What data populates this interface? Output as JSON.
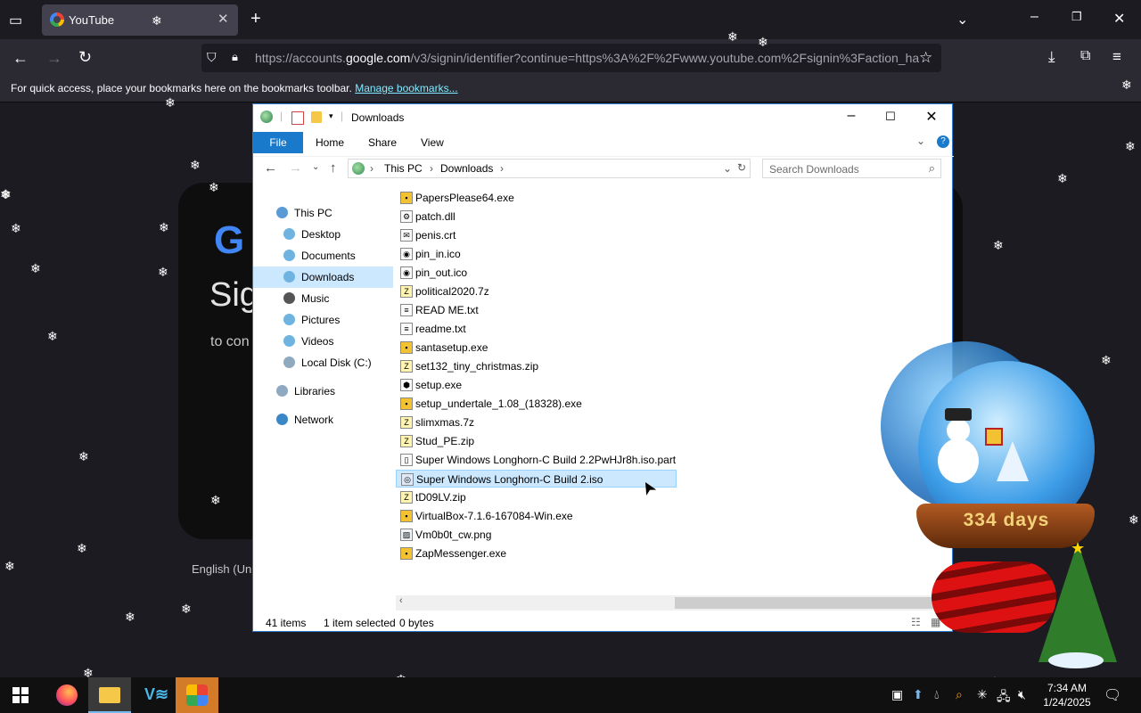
{
  "browser": {
    "tab_title": "YouTube",
    "url_prefix": "https://accounts.",
    "url_domain": "google.com",
    "url_rest": "/v3/signin/identifier?continue=https%3A%2F%2Fwww.youtube.com%2Fsignin%3Faction_ha",
    "bookmarks_text": "For quick access, place your bookmarks here on the bookmarks toolbar.",
    "bookmarks_link": "Manage bookmarks..."
  },
  "signin": {
    "title": "Sig",
    "subtitle": "to con",
    "language": "English (Uni"
  },
  "explorer": {
    "title": "Downloads",
    "tabs": [
      "File",
      "Home",
      "Share",
      "View"
    ],
    "breadcrumb": [
      "This PC",
      "Downloads"
    ],
    "search_placeholder": "Search Downloads",
    "nav_items": [
      {
        "label": "This PC",
        "icon": "computer-icon",
        "color": "#5b9bd5"
      },
      {
        "label": "Desktop",
        "icon": "desktop-icon",
        "color": "#6fb3e0"
      },
      {
        "label": "Documents",
        "icon": "documents-icon",
        "color": "#6fb3e0"
      },
      {
        "label": "Downloads",
        "icon": "downloads-icon",
        "color": "#6fb3e0"
      },
      {
        "label": "Music",
        "icon": "music-icon",
        "color": "#555555"
      },
      {
        "label": "Pictures",
        "icon": "pictures-icon",
        "color": "#6fb3e0"
      },
      {
        "label": "Videos",
        "icon": "videos-icon",
        "color": "#6fb3e0"
      },
      {
        "label": "Local Disk (C:)",
        "icon": "disk-icon",
        "color": "#8fa9c0"
      },
      {
        "label": "Libraries",
        "icon": "libraries-icon",
        "color": "#8fa9c0"
      },
      {
        "label": "Network",
        "icon": "network-icon",
        "color": "#3a87c8"
      }
    ],
    "files": [
      {
        "name": "PapersPlease64.exe",
        "icon": "exe-icon"
      },
      {
        "name": "patch.dll",
        "icon": "dll-icon"
      },
      {
        "name": "penis.crt",
        "icon": "certificate-icon"
      },
      {
        "name": "pin_in.ico",
        "icon": "ico-icon"
      },
      {
        "name": "pin_out.ico",
        "icon": "ico-icon"
      },
      {
        "name": "political2020.7z",
        "icon": "archive-icon"
      },
      {
        "name": "READ ME.txt",
        "icon": "text-file-icon"
      },
      {
        "name": "readme.txt",
        "icon": "text-file-icon"
      },
      {
        "name": "santasetup.exe",
        "icon": "exe-icon"
      },
      {
        "name": "set132_tiny_christmas.zip",
        "icon": "archive-icon"
      },
      {
        "name": "setup.exe",
        "icon": "setup-icon"
      },
      {
        "name": "setup_undertale_1.08_(18328).exe",
        "icon": "exe-icon"
      },
      {
        "name": "slimxmas.7z",
        "icon": "archive-icon"
      },
      {
        "name": "Stud_PE.zip",
        "icon": "archive-icon"
      },
      {
        "name": "Super Windows Longhorn-C Build 2.2PwHJr8h.iso.part",
        "icon": "file-icon"
      },
      {
        "name": "Super Windows Longhorn-C Build 2.iso",
        "icon": "iso-icon",
        "selected": true
      },
      {
        "name": "tD09LV.zip",
        "icon": "archive-icon"
      },
      {
        "name": "VirtualBox-7.1.6-167084-Win.exe",
        "icon": "exe-icon"
      },
      {
        "name": "Vm0b0t_cw.png",
        "icon": "image-icon"
      },
      {
        "name": "ZapMessenger.exe",
        "icon": "exe-icon"
      }
    ],
    "status": {
      "items": "41 items",
      "selected": "1 item selected",
      "size": "0 bytes"
    }
  },
  "widget": {
    "counter_text": "334 days"
  },
  "taskbar": {
    "time": "7:34 AM",
    "date": "1/24/2025"
  }
}
